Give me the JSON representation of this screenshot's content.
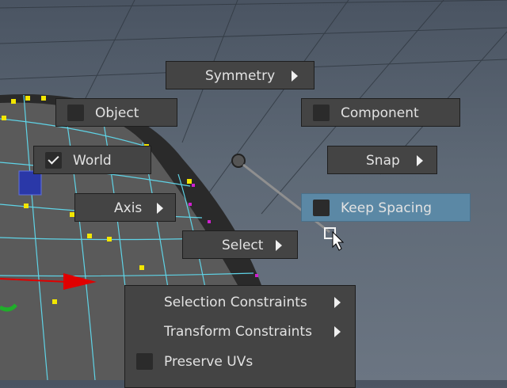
{
  "marking_menu": {
    "symmetry": {
      "label": "Symmetry"
    },
    "object": {
      "label": "Object",
      "checked": false
    },
    "component": {
      "label": "Component",
      "checked": false
    },
    "world": {
      "label": "World",
      "checked": true
    },
    "snap": {
      "label": "Snap"
    },
    "axis": {
      "label": "Axis"
    },
    "keep_spacing": {
      "label": "Keep Spacing",
      "checked": false,
      "highlighted": true
    },
    "select": {
      "label": "Select"
    }
  },
  "submenu": {
    "items": [
      {
        "label": "Selection Constraints",
        "has_submenu": true
      },
      {
        "label": "Transform Constraints",
        "has_submenu": true
      },
      {
        "label": "Preserve UVs",
        "checked": false
      }
    ]
  },
  "colors": {
    "menu_bg": "#444444",
    "highlight": "#5b88a5",
    "wireframe": "#5fd3e6",
    "vertex": "#f2e600",
    "axis_x": "#e00000",
    "axis_y": "#1fae2a"
  },
  "icons": [
    "checkbox-icon",
    "checkmark-icon",
    "submenu-arrow-icon",
    "cursor-arrow-icon"
  ]
}
